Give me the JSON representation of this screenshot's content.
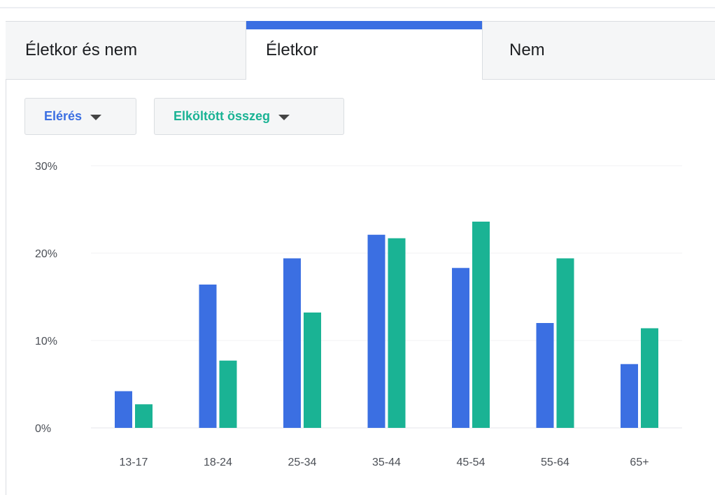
{
  "tabs": [
    {
      "label": "Életkor és nem"
    },
    {
      "label": "Életkor"
    },
    {
      "label": "Nem"
    }
  ],
  "active_tab": "Életkor",
  "dropdowns": {
    "reach": {
      "label": "Elérés"
    },
    "spend": {
      "label": "Elköltött összeg"
    }
  },
  "colors": {
    "reach": "#3b6fe2",
    "spend": "#1ab394",
    "active_tab_accent": "#3b6fe2"
  },
  "chart_data": {
    "type": "bar",
    "categories": [
      "13-17",
      "18-24",
      "25-34",
      "35-44",
      "45-54",
      "55-64",
      "65+"
    ],
    "series": [
      {
        "values": [
          4.2,
          16.4,
          19.4,
          22.1,
          18.3,
          12.0,
          7.3
        ],
        "color": "#3b6fe2"
      },
      {
        "values": [
          2.7,
          7.7,
          13.2,
          21.7,
          23.6,
          19.4,
          11.4
        ],
        "color": "#1ab394"
      }
    ],
    "yticks": [
      "0%",
      "10%",
      "20%",
      "30%"
    ],
    "ylim": [
      0,
      30
    ],
    "grid": true
  }
}
